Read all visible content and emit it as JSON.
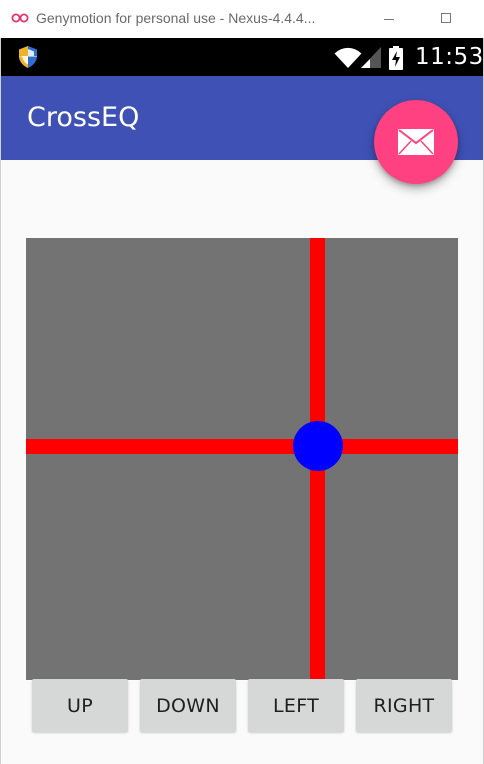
{
  "window": {
    "title": "Genymotion for personal use - Nexus-4.4.4...",
    "icon": "genymotion-logo-icon",
    "controls": [
      "minimize-icon",
      "maximize-icon"
    ]
  },
  "statusbar": {
    "time": "11:53",
    "icons": [
      "shield-notification-icon",
      "wifi-icon",
      "cell-signal-icon",
      "battery-charging-icon"
    ]
  },
  "appbar": {
    "title": "CrossEQ",
    "color": "#3f51b5"
  },
  "fab": {
    "icon": "mail-icon",
    "color": "#ff4081"
  },
  "cross_view": {
    "background": "#737373",
    "line_color": "#ff0000",
    "dot_color": "#0000ff"
  },
  "buttons": {
    "up": "UP",
    "down": "DOWN",
    "left": "LEFT",
    "right": "RIGHT"
  }
}
